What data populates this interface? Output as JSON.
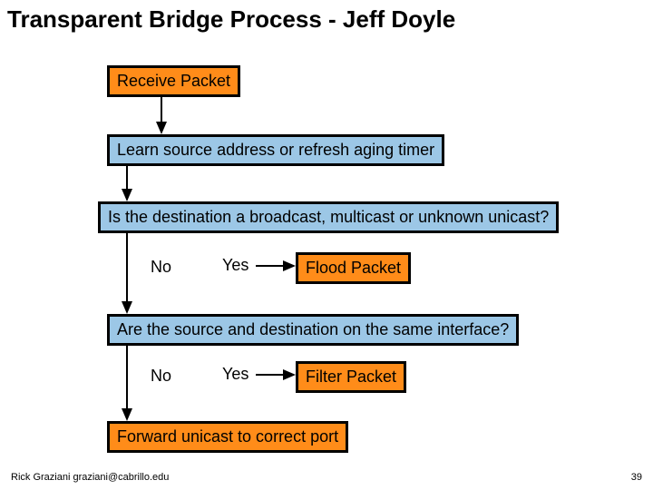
{
  "title": "Transparent Bridge Process - Jeff Doyle",
  "steps": {
    "receive": "Receive Packet",
    "learn": "Learn source address or refresh aging timer",
    "decision1": "Is the destination a broadcast, multicast or unknown unicast?",
    "flood": "Flood Packet",
    "decision2": "Are the source and destination on the same interface?",
    "filter": "Filter Packet",
    "forward": "Forward unicast to correct port"
  },
  "labels": {
    "no": "No",
    "yes": "Yes"
  },
  "footer": {
    "author": "Rick Graziani  graziani@cabrillo.edu",
    "page": "39"
  },
  "colors": {
    "orange": "#ff8c19",
    "blue": "#9cc7e6"
  }
}
